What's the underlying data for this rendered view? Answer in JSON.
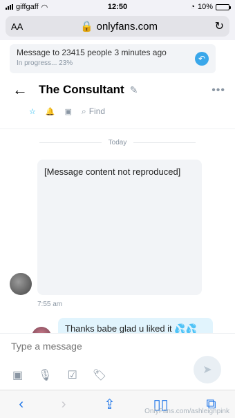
{
  "status": {
    "carrier": "giffgaff",
    "time": "12:50",
    "battery": "10%"
  },
  "browser": {
    "text_size": "AA",
    "url": "onlyfans.com"
  },
  "notice": {
    "title": "Message to 23415 people 3 minutes ago",
    "progress": "In progress... 23%"
  },
  "chat": {
    "title": "The Consultant",
    "find_label": "Find",
    "day": "Today"
  },
  "messages": {
    "incoming_text": "[Message content not reproduced]",
    "incoming_time": "7:55 am",
    "outgoing_text": "Thanks babe glad u liked it 💦💦"
  },
  "composer": {
    "placeholder": "Type a message"
  },
  "watermark": "OnlyFans.com/ashleighpink"
}
